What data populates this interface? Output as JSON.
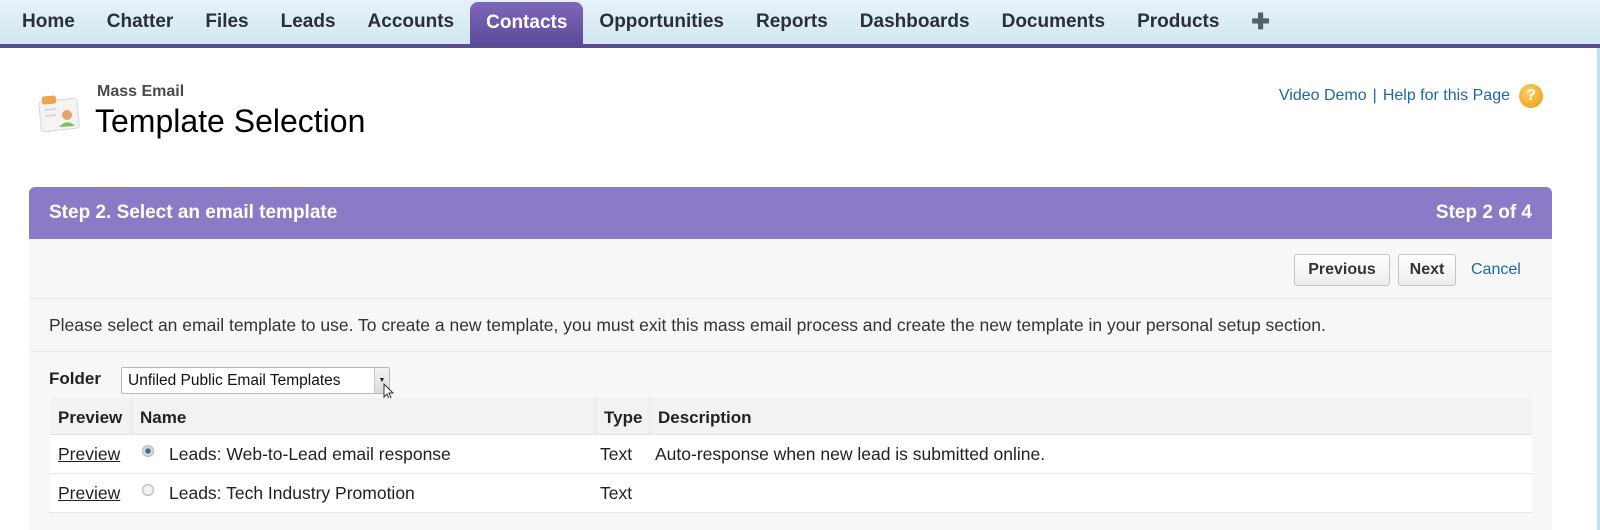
{
  "nav": {
    "tabs": [
      {
        "label": "Home",
        "active": false
      },
      {
        "label": "Chatter",
        "active": false
      },
      {
        "label": "Files",
        "active": false
      },
      {
        "label": "Leads",
        "active": false
      },
      {
        "label": "Accounts",
        "active": false
      },
      {
        "label": "Contacts",
        "active": true
      },
      {
        "label": "Opportunities",
        "active": false
      },
      {
        "label": "Reports",
        "active": false
      },
      {
        "label": "Dashboards",
        "active": false
      },
      {
        "label": "Documents",
        "active": false
      },
      {
        "label": "Products",
        "active": false
      }
    ],
    "add_tab_glyph": "✚",
    "accent_color": "#5b4b95"
  },
  "header": {
    "icon": "contact-card-icon",
    "breadcrumb": "Mass Email",
    "title": "Template Selection",
    "video_demo_label": "Video Demo",
    "separator": "|",
    "help_label": "Help for this Page",
    "help_icon_glyph": "?"
  },
  "step": {
    "title": "Step 2. Select an email template",
    "progress": "Step 2 of 4",
    "current_step": 2,
    "total_steps": 4,
    "header_color": "#8b7bc7",
    "previous_label": "Previous",
    "next_label": "Next",
    "cancel_label": "Cancel",
    "instructions": "Please select an email template to use. To create a new template, you must exit this mass email process and create the new template in your personal setup section.",
    "folder_label": "Folder",
    "folder_value": "Unfiled Public Email Templates",
    "folder_arrow_glyph": "▼"
  },
  "table": {
    "columns": [
      "Preview",
      "Name",
      "Type",
      "Description"
    ],
    "rows": [
      {
        "preview": "Preview",
        "selected": true,
        "name": "Leads: Web-to-Lead email response",
        "type": "Text",
        "description": "Auto-response when new lead is submitted online."
      },
      {
        "preview": "Preview",
        "selected": false,
        "name": "Leads: Tech Industry Promotion",
        "type": "Text",
        "description": ""
      }
    ]
  }
}
